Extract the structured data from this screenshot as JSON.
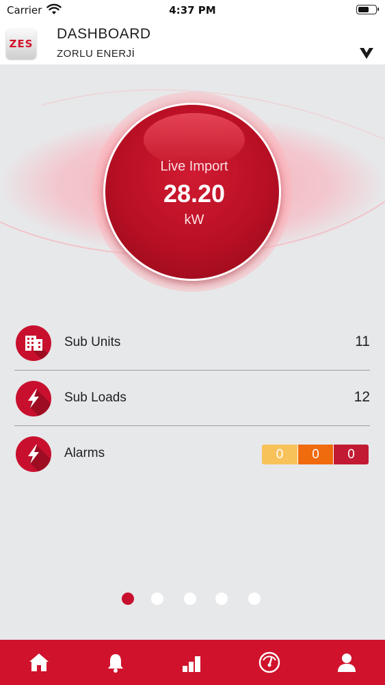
{
  "status_bar": {
    "carrier": "Carrier",
    "time": "4:37 PM"
  },
  "header": {
    "logo_text": "ZES",
    "title": "DASHBOARD",
    "subtitle": "ZORLU ENERJİ",
    "chevron_icon": "chevron-down-icon"
  },
  "gauge": {
    "label": "Live Import",
    "value": "28.20",
    "unit": "kW"
  },
  "list": {
    "sub_units": {
      "label": "Sub Units",
      "count": "11",
      "icon": "building-icon"
    },
    "sub_loads": {
      "label": "Sub Loads",
      "count": "12",
      "icon": "lightning-icon"
    },
    "alarms": {
      "label": "Alarms",
      "icon": "lightning-icon",
      "low": "0",
      "medium": "0",
      "high": "0"
    }
  },
  "pager": {
    "pages": 5,
    "active": 1
  },
  "tab_bar": {
    "tabs": [
      "home-icon",
      "bell-icon",
      "bar-chart-icon",
      "gauge-icon",
      "user-icon"
    ]
  },
  "colors": {
    "brand_red": "#c8102e",
    "alarm_low": "#f8c25a",
    "alarm_medium": "#f06a0e",
    "alarm_high": "#c21a33",
    "background": "#e7e8ea"
  }
}
